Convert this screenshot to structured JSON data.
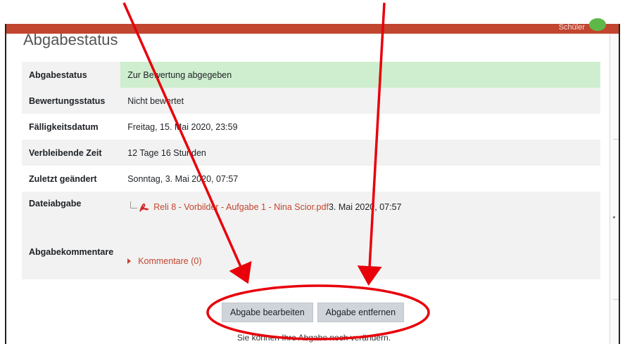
{
  "window": {
    "role_label": "Schüler"
  },
  "page": {
    "heading": "Abgabestatus"
  },
  "status_rows": [
    {
      "label": "Abgabestatus",
      "value": "Zur Bewertung abgegeben"
    },
    {
      "label": "Bewertungsstatus",
      "value": "Nicht bewertet"
    },
    {
      "label": "Fälligkeitsdatum",
      "value": "Freitag, 15. Mai 2020, 23:59"
    },
    {
      "label": "Verbleibende Zeit",
      "value": "12 Tage 16 Stunden"
    },
    {
      "label": "Zuletzt geändert",
      "value": "Sonntag, 3. Mai 2020, 07:57"
    }
  ],
  "file_submission": {
    "label": "Dateiabgabe",
    "file_name": "Reli 8 - Vorbilder - Aufgabe 1 - Nina Scior.pdf",
    "file_date": "3. Mai 2020, 07:57"
  },
  "comments": {
    "label": "Abgabekommentare",
    "link": "Kommentare (0)"
  },
  "actions": {
    "edit_label": "Abgabe bearbeiten",
    "remove_label": "Abgabe entfernen",
    "note": "Sie können Ihre Abgabe noch verändern."
  },
  "colors": {
    "accent": "#c2452f",
    "submitted_bg": "#cfeecf",
    "annotation": "#e8000b"
  }
}
